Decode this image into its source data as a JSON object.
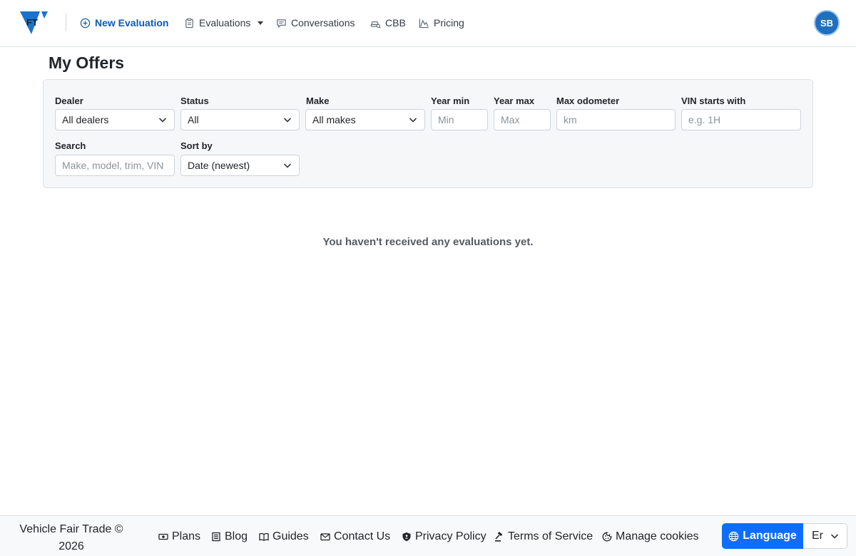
{
  "header": {
    "logo_text": "FT",
    "nav": {
      "new_evaluation": "New Evaluation",
      "evaluations": "Evaluations",
      "conversations": "Conversations",
      "cbb": "CBB",
      "pricing": "Pricing"
    },
    "avatar_initials": "SB",
    "colors": {
      "primary": "#0d5bb5",
      "avatar": "#1f6fbf"
    }
  },
  "page": {
    "title": "My Offers",
    "empty_message": "You haven't received any evaluations yet."
  },
  "filters": {
    "dealer": {
      "label": "Dealer",
      "value": "All dealers"
    },
    "status": {
      "label": "Status",
      "value": "All"
    },
    "make": {
      "label": "Make",
      "value": "All makes"
    },
    "year_min": {
      "label": "Year min",
      "placeholder": "Min"
    },
    "year_max": {
      "label": "Year max",
      "placeholder": "Max"
    },
    "max_odometer": {
      "label": "Max odometer",
      "placeholder": "km"
    },
    "vin": {
      "label": "VIN starts with",
      "placeholder": "e.g. 1H"
    },
    "search": {
      "label": "Search",
      "placeholder": "Make, model, trim, VIN"
    },
    "sort_by": {
      "label": "Sort by",
      "value": "Date (newest)"
    }
  },
  "footer": {
    "copyright_line1": "Vehicle Fair Trade ©",
    "copyright_line2": "2026",
    "links": {
      "plans": "Plans",
      "blog": "Blog",
      "guides": "Guides",
      "contact": "Contact Us",
      "privacy": "Privacy Policy",
      "terms": "Terms of Service",
      "cookies": "Manage cookies"
    },
    "language_button": "Language",
    "language_value": "Er",
    "colors": {
      "language_button": "#0d6efd"
    }
  }
}
